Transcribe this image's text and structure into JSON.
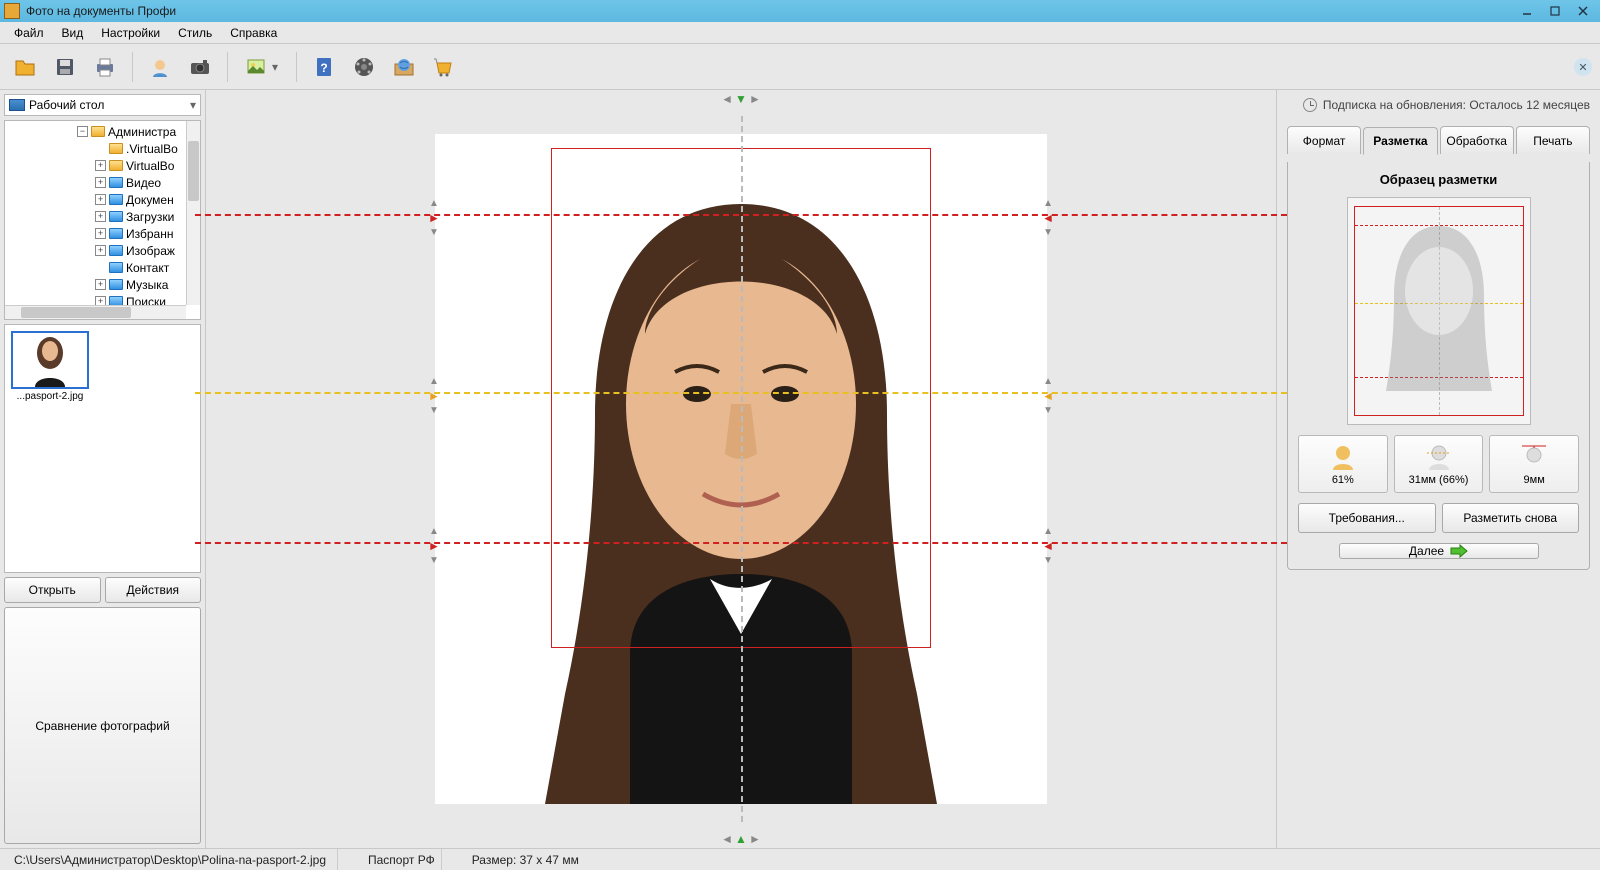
{
  "title": "Фото на документы Профи",
  "menu": {
    "file": "Файл",
    "view": "Вид",
    "settings": "Настройки",
    "style": "Стиль",
    "help": "Справка"
  },
  "subscription": "Подписка на обновления: Осталось 12 месяцев",
  "sidebar": {
    "crumb": "Рабочий стол",
    "tree": {
      "root": "Администра",
      "items": [
        ".VirtualBo",
        "VirtualBo",
        "Видео",
        "Докумен",
        "Загрузки",
        "Избранн",
        "Изображ",
        "Контакт",
        "Музыка",
        "Поиски"
      ]
    },
    "thumb_caption": "...pasport-2.jpg",
    "open": "Открыть",
    "actions": "Действия",
    "compare": "Сравнение фотографий"
  },
  "tabs": {
    "format": "Формат",
    "markup": "Разметка",
    "processing": "Обработка",
    "print": "Печать"
  },
  "tabbody": {
    "title": "Образец разметки",
    "metrics": {
      "a": "61%",
      "b": "31мм (66%)",
      "c": "9мм"
    },
    "requirements": "Требования...",
    "remark": "Разметить снова",
    "next": "Далее"
  },
  "status": {
    "path": "C:\\Users\\Администратор\\Desktop\\Polina-na-pasport-2.jpg",
    "doc": "Паспорт РФ",
    "size": "Размер: 37 x 47 мм"
  }
}
